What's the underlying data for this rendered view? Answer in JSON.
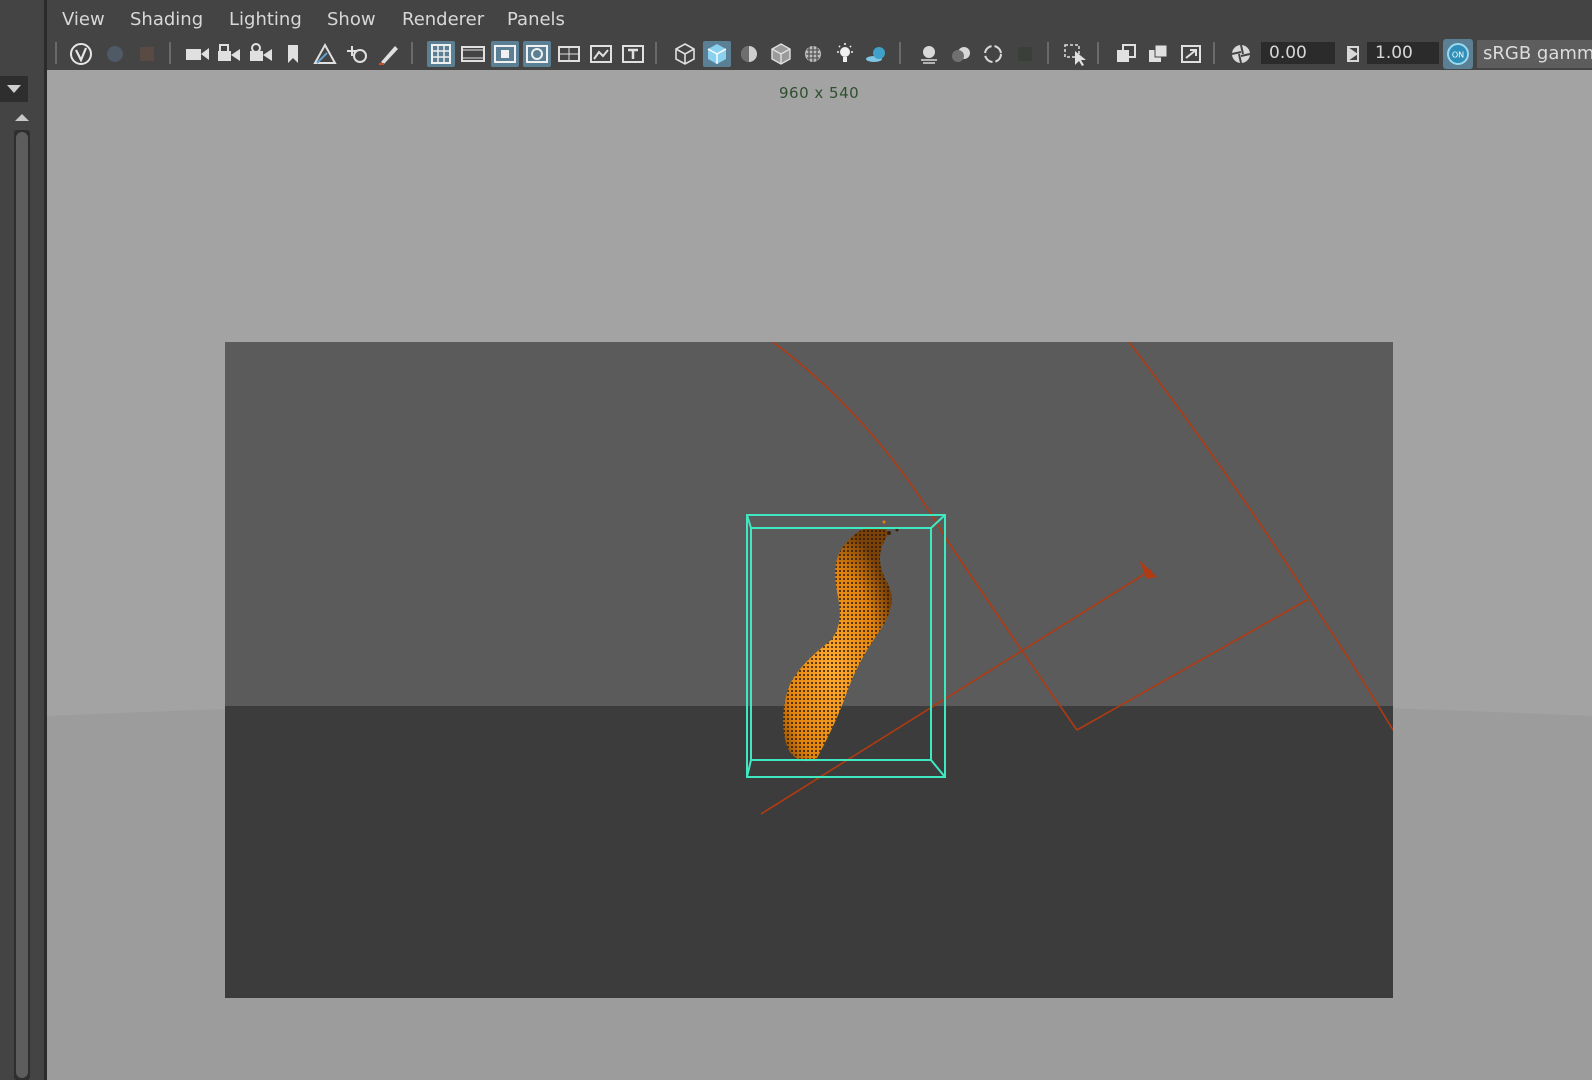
{
  "menu": {
    "items": [
      "View",
      "Shading",
      "Lighting",
      "Show",
      "Renderer",
      "Panels"
    ]
  },
  "toolbar": {
    "groups": [
      [
        "select-camera-icon",
        "camera-attributes-icon",
        "bookmark-icon"
      ],
      [
        "camera-icon",
        "lock-camera-icon",
        "camera-tumble-icon",
        "camera-bookmark-icon",
        "image-plane-icon",
        "2d-pan-zoom-icon",
        "grease-pencil-icon"
      ],
      [
        "grid-icon",
        "film-gate-icon",
        "resolution-gate-icon",
        "gate-mask-icon",
        "field-chart-icon",
        "safe-action-icon",
        "safe-title-icon"
      ],
      [
        "wireframe-icon",
        "smooth-shade-icon",
        "default-lighting-icon",
        "wireframe-on-shaded-icon",
        "textured-icon",
        "use-all-lights-icon",
        "shadows-icon"
      ],
      [
        "screen-space-ao-icon",
        "motion-blur-icon",
        "anti-aliasing-icon",
        "depth-of-field-icon"
      ],
      [
        "isolate-select-icon"
      ],
      [
        "xray-icon",
        "xray-joints-icon",
        "xray-components-icon"
      ],
      [
        "exposure-icon",
        "gamma-icon",
        "color-management-icon"
      ]
    ],
    "exposure_value": "0.00",
    "gamma_value": "1.00",
    "color_management_badge": "ON",
    "color_space": "sRGB gamma"
  },
  "viewport": {
    "resolution_label": "960 x 540",
    "colors": {
      "background": "#a3a3a3",
      "gate_upper": "#5b5b5b",
      "gate_lower": "#3c3c3c",
      "selection_box": "#3fe8c0",
      "particles": "#f0900f",
      "field_lines": "#b03a12"
    }
  }
}
